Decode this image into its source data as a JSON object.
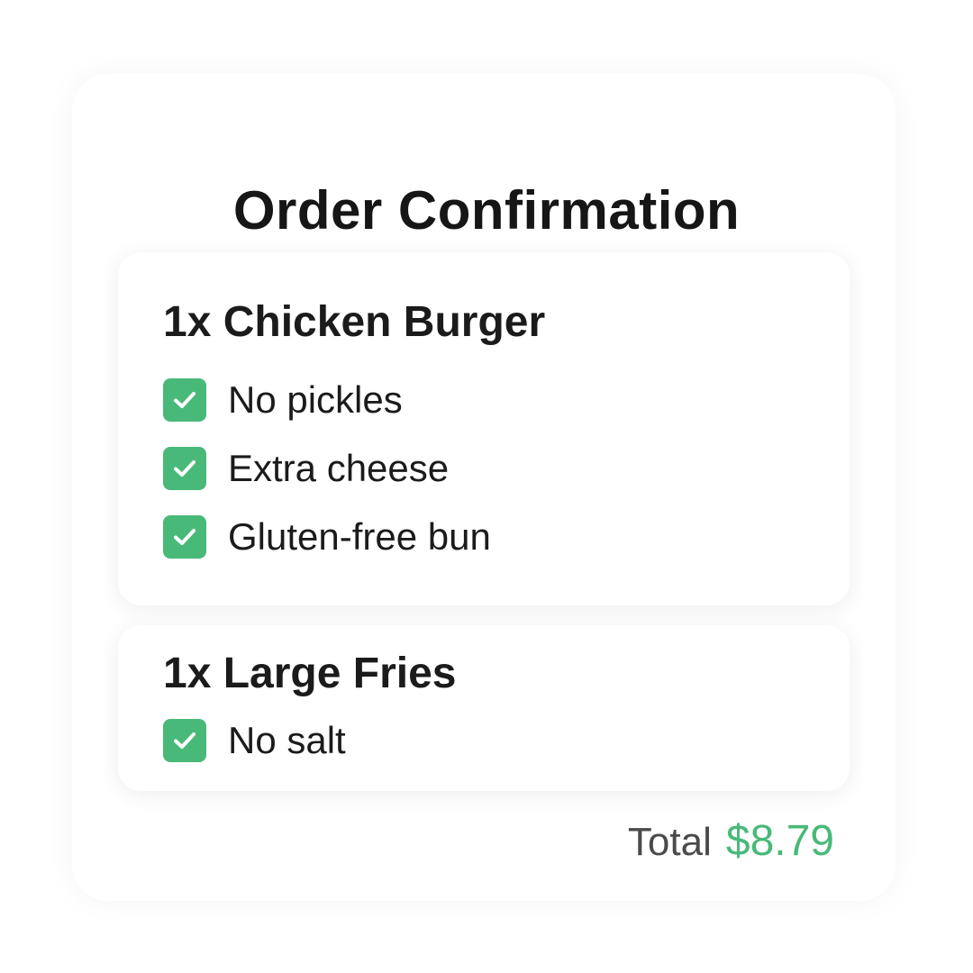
{
  "page": {
    "title": "Order Confirmation"
  },
  "order": {
    "items": [
      {
        "title": "1x Chicken Burger",
        "modifiers": [
          {
            "label": "No pickles",
            "checked": true
          },
          {
            "label": "Extra cheese",
            "checked": true
          },
          {
            "label": "Gluten-free bun",
            "checked": true
          }
        ]
      },
      {
        "title": "1x Large Fries",
        "modifiers": [
          {
            "label": "No salt",
            "checked": true
          }
        ]
      }
    ],
    "total_label": "Total",
    "total_value": "$8.79"
  },
  "icons": {
    "checkbox": "check-icon"
  },
  "colors": {
    "accent_green": "#48b978",
    "text_dark": "#1b1b1b",
    "text_muted": "#4a4a4a",
    "background": "#ffffff"
  }
}
